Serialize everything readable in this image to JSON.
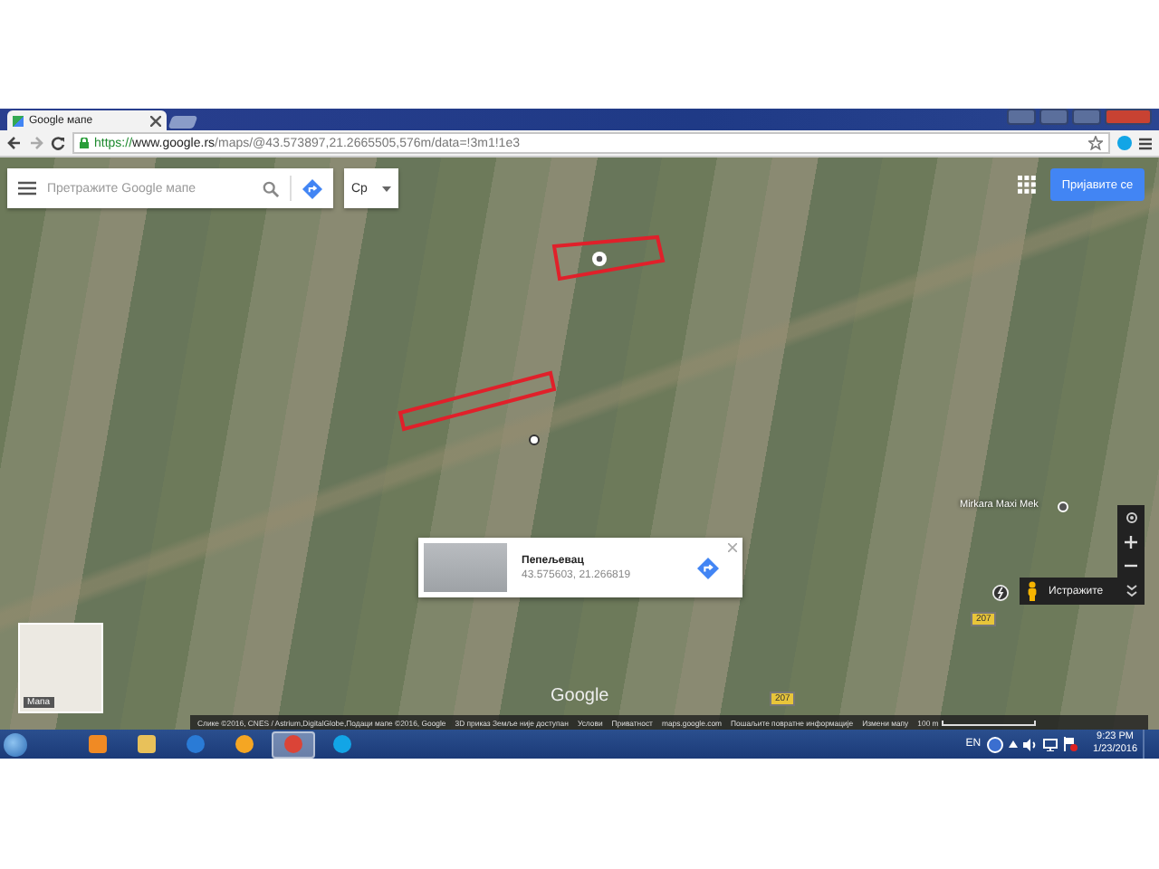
{
  "browser": {
    "tab_title": "Google мапе",
    "url_secure": "https://",
    "url_host": "www.google.rs",
    "url_path": "/maps/@43.573897,21.2665505,576m/data=!3m1!1e3"
  },
  "map": {
    "search": {
      "placeholder": "Претражите Google мапе"
    },
    "language": "Ср",
    "sign_in": "Пријавите се",
    "place_label": "Mirkara Maxi Mek",
    "road_labels": [
      "207",
      "207"
    ],
    "info_card": {
      "title": "Пепељевац",
      "coordinates": "43.575603, 21.266819"
    },
    "minimap_label": "Мапа",
    "logo": "Google",
    "pegman_label": "Истражите",
    "attribution": [
      {
        "kind": "text",
        "text": "Слике ©2016, CNES / Astrium,DigitalGlobe,Подаци мапе ©2016, Google"
      },
      {
        "kind": "text",
        "text": "3D приказ Земље није доступан"
      },
      {
        "kind": "link",
        "text": "Услови"
      },
      {
        "kind": "link",
        "text": "Приватност"
      },
      {
        "kind": "link",
        "text": "maps.google.com"
      },
      {
        "kind": "link",
        "text": "Пошаљите повратне информације"
      },
      {
        "kind": "link",
        "text": "Измени мапу"
      },
      {
        "kind": "scale",
        "text": "100 m"
      }
    ]
  },
  "taskbar": {
    "apps": [
      {
        "kind": "media",
        "selected": false
      },
      {
        "kind": "folder",
        "selected": false
      },
      {
        "kind": "ie",
        "selected": false
      },
      {
        "kind": "orange",
        "selected": false
      },
      {
        "kind": "chrome",
        "selected": true
      },
      {
        "kind": "skype",
        "selected": false
      }
    ],
    "language": "EN",
    "time": "9:23 PM",
    "date": "1/23/2016"
  }
}
